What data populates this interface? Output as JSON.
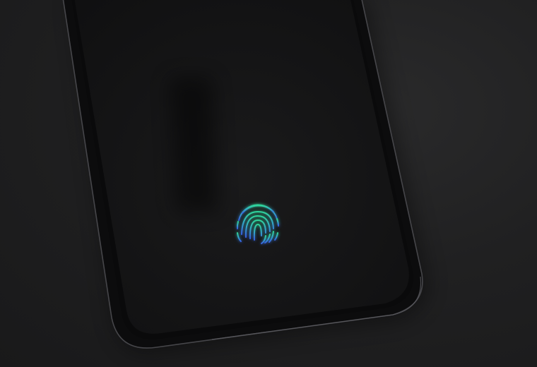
{
  "scene": {
    "subject": "smartphone-lower-half",
    "screen_state": "off",
    "icon": "fingerprint-icon"
  },
  "colors": {
    "table_surface": "#1d1d1e",
    "phone_frame": "#0c0c0d",
    "frame_highlight": "#4a4a4e",
    "screen": "#141415",
    "fingerprint_top": "#2fd49a",
    "fingerprint_mid": "#33a8c8",
    "fingerprint_bottom": "#3560e0"
  }
}
